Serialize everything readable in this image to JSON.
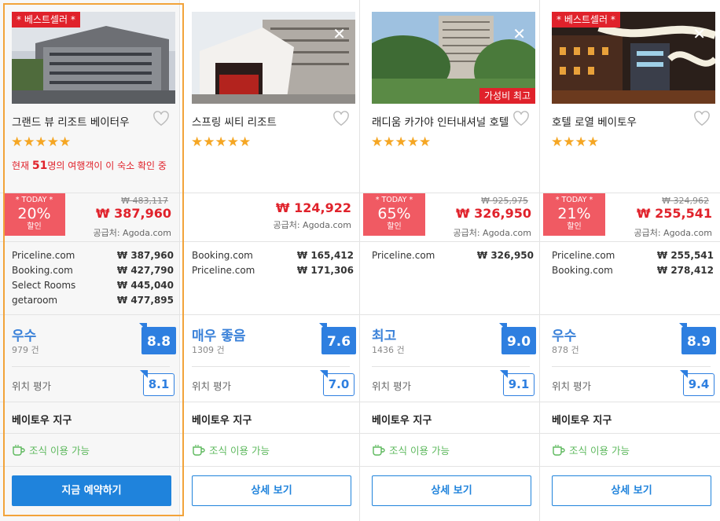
{
  "colors": {
    "accent": "#1f83dc",
    "sale_red": "#e0222b",
    "star": "#f5a623",
    "highlight": "#f2a33a",
    "green": "#5cb85c"
  },
  "hotels": [
    {
      "badge": "* 베스트셀러 *",
      "name": "그랜드 뷰 리조트 베이터우",
      "stars": "★★★★★",
      "viewers_prefix": "현재 ",
      "viewers_count": "51",
      "viewers_suffix": "명의 여행객이 이 숙소 확인 중",
      "deal": {
        "today": "* TODAY *",
        "percent": "20%",
        "label": "할인"
      },
      "original_price": "₩ 483,117",
      "price": "₩ 387,960",
      "supplier": "공급처: Agoda.com",
      "offers": [
        {
          "site": "Priceline.com",
          "price": "₩ 387,960"
        },
        {
          "site": "Booking.com",
          "price": "₩ 427,790"
        },
        {
          "site": "Select Rooms",
          "price": "₩ 445,040"
        },
        {
          "site": "getaroom",
          "price": "₩ 477,895"
        }
      ],
      "rating_label": "우수",
      "rating_count": "979 건",
      "score": "8.8",
      "location_label": "위치 평가",
      "location_score": "8.1",
      "district": "베이토우 지구",
      "breakfast": "조식 이용 가능",
      "button": "지금 예약하기"
    },
    {
      "name": "스프링 씨티 리조트",
      "stars": "★★★★★",
      "price": "₩ 124,922",
      "supplier": "공급처: Agoda.com",
      "offers": [
        {
          "site": "Booking.com",
          "price": "₩ 165,412"
        },
        {
          "site": "Priceline.com",
          "price": "₩ 171,306"
        }
      ],
      "rating_label": "매우 좋음",
      "rating_count": "1309 건",
      "score": "7.6",
      "location_label": "위치 평가",
      "location_score": "7.0",
      "district": "베이토우 지구",
      "breakfast": "조식 이용 가능",
      "button": "상세 보기"
    },
    {
      "value_tag": "가성비 최고",
      "name": "래디움 카가야 인터내셔널 호텔",
      "stars": "★★★★★",
      "deal": {
        "today": "* TODAY *",
        "percent": "65%",
        "label": "할인"
      },
      "original_price": "₩ 925,975",
      "price": "₩ 326,950",
      "supplier": "공급처: Agoda.com",
      "offers": [
        {
          "site": "Priceline.com",
          "price": "₩ 326,950"
        }
      ],
      "rating_label": "최고",
      "rating_count": "1436 건",
      "score": "9.0",
      "location_label": "위치 평가",
      "location_score": "9.1",
      "district": "베이토우 지구",
      "breakfast": "조식 이용 가능",
      "button": "상세 보기"
    },
    {
      "badge": "* 베스트셀러 *",
      "name": "호텔 로열 베이토우",
      "stars": "★★★★",
      "deal": {
        "today": "* TODAY *",
        "percent": "21%",
        "label": "할인"
      },
      "original_price": "₩ 324,962",
      "price": "₩ 255,541",
      "supplier": "공급처: Agoda.com",
      "offers": [
        {
          "site": "Priceline.com",
          "price": "₩ 255,541"
        },
        {
          "site": "Booking.com",
          "price": "₩ 278,412"
        }
      ],
      "rating_label": "우수",
      "rating_count": "878 건",
      "score": "8.9",
      "location_label": "위치 평가",
      "location_score": "9.4",
      "district": "베이토우 지구",
      "breakfast": "조식 이용 가능",
      "button": "상세 보기"
    }
  ]
}
